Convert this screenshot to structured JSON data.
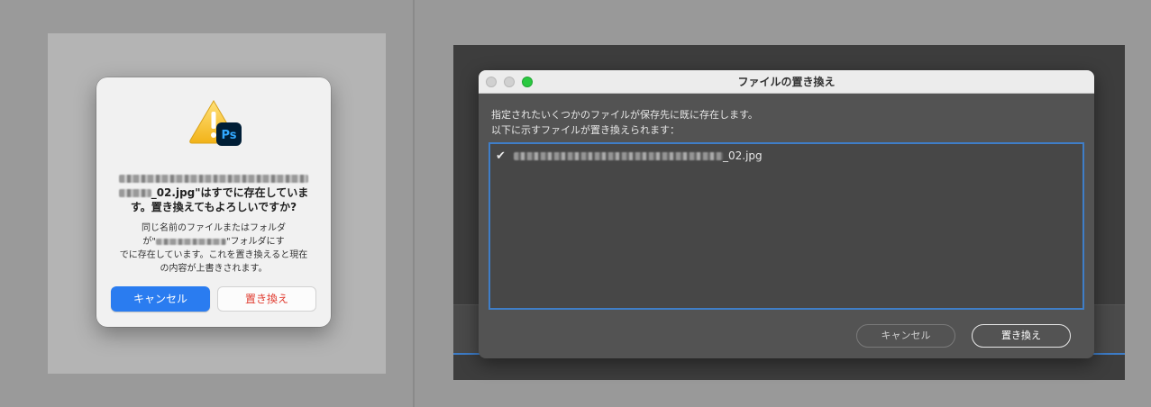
{
  "mac_alert": {
    "app_icon": "photoshop-warning-icon",
    "badge_text": "Ps",
    "title_file_suffix": "_02.jpg\"",
    "title_rest": "はすでに存在しています。置き換えてもよろしいですか?",
    "body_line1": "同じ名前のファイルまたはフォルダ",
    "body_line2_prefix": "が\"",
    "body_line2_suffix": "\"フォルダにす",
    "body_rest": "でに存在しています。これを置き換えると現在の内容が上書きされます。",
    "cancel_label": "キャンセル",
    "replace_label": "置き換え",
    "accent_color": "#2a7cf0",
    "destructive_color": "#e03a2e"
  },
  "ps_dialog": {
    "title": "ファイルの置き換え",
    "message_line1": "指定されたいくつかのファイルが保存先に既に存在します。",
    "message_line2": "以下に示すファイルが置き換えられます：",
    "files": [
      {
        "check": "✔",
        "name_suffix": "_02.jpg"
      }
    ],
    "cancel_label": "キャンセル",
    "replace_label": "置き換え",
    "list_border_color": "#3f7ec8"
  }
}
